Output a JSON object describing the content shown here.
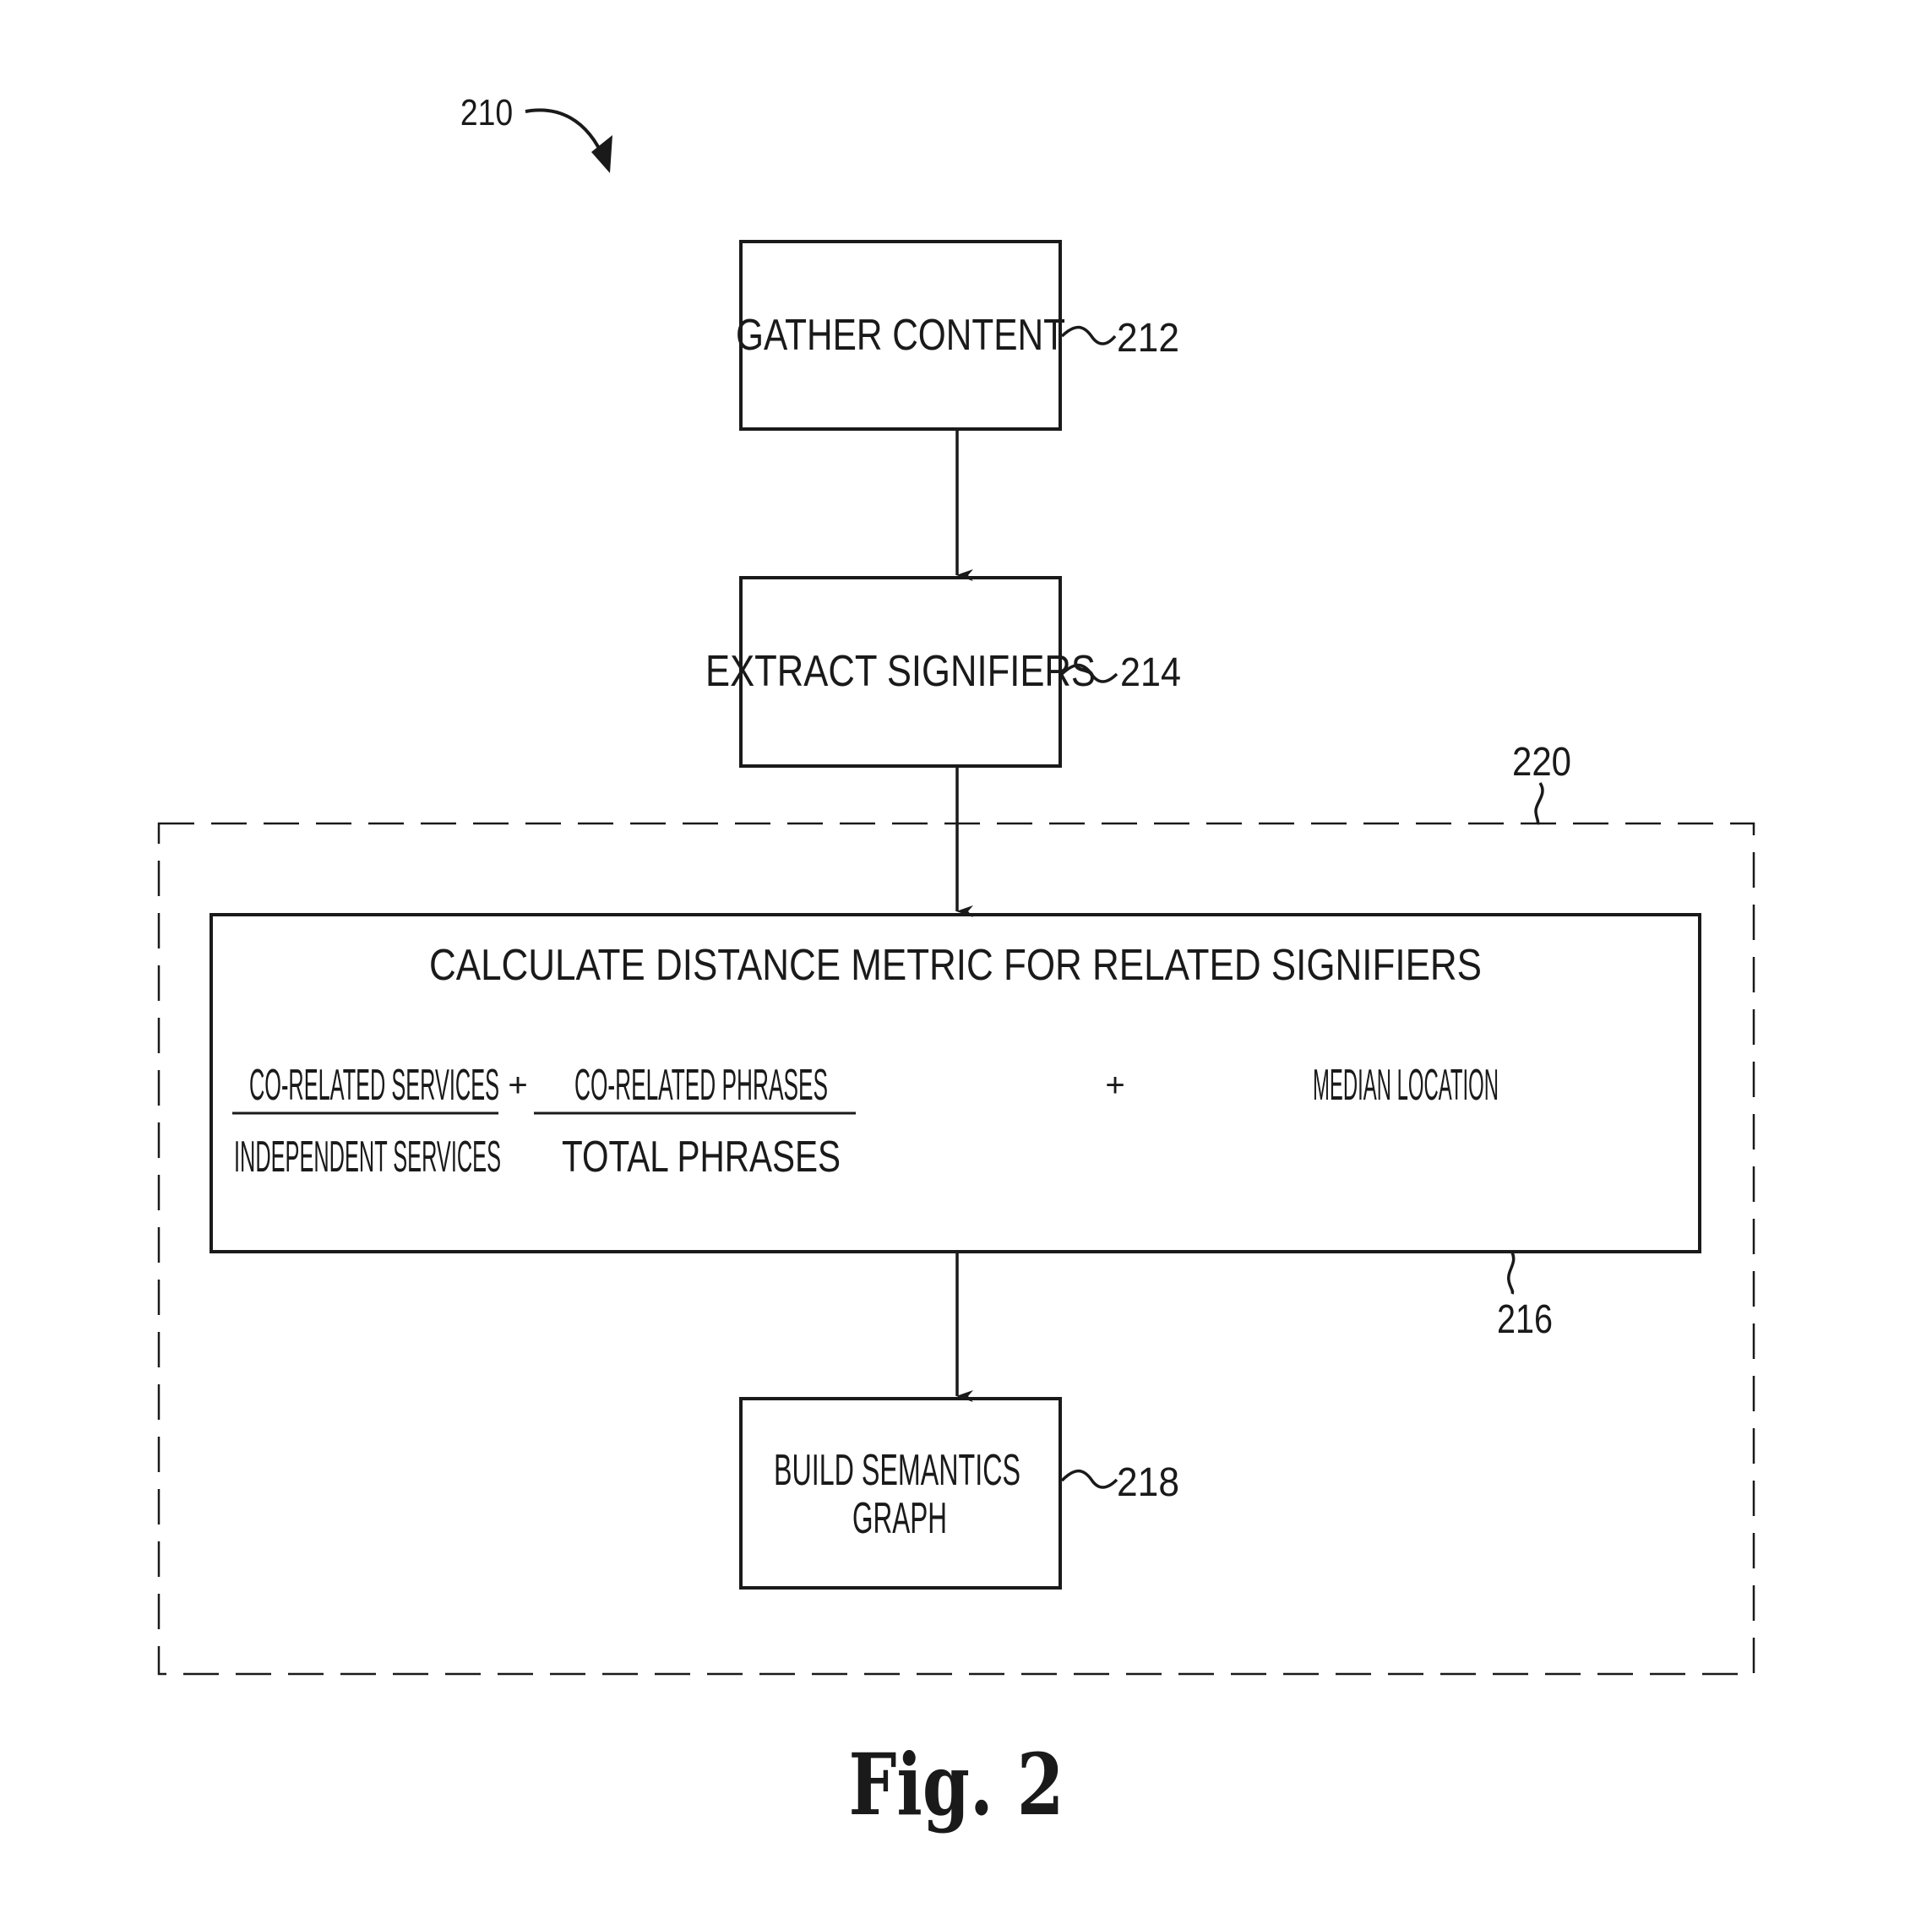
{
  "figure": {
    "ref_label": "210",
    "caption": "Fig. 2",
    "colors": {
      "ink": "#1a1a1a",
      "background": "#ffffff"
    }
  },
  "steps": [
    {
      "id": "gather-content",
      "ref": "212",
      "lines": [
        "GATHER CONTENT"
      ]
    },
    {
      "id": "extract-signifiers",
      "ref": "214",
      "lines": [
        "EXTRACT SIGNIFIERS"
      ]
    },
    {
      "id": "calculate-distance-metric",
      "ref": "216",
      "title": "CALCULATE DISTANCE METRIC FOR RELATED SIGNIFIERS"
    },
    {
      "id": "build-semantics-graph",
      "ref": "218",
      "lines": [
        "BUILD SEMANTICS",
        "GRAPH"
      ]
    }
  ],
  "group": {
    "id": "distance-and-graph-group",
    "ref": "220"
  },
  "formula": {
    "term1": {
      "numerator": "CO-RELATED SERVICES",
      "denominator": "INDEPENDENT SERVICES"
    },
    "op1": "+",
    "term2": {
      "numerator": "CO-RELATED PHRASES",
      "denominator": "TOTAL PHRASES"
    },
    "op2": "+",
    "term3": "MEDIAN LOCATION"
  }
}
